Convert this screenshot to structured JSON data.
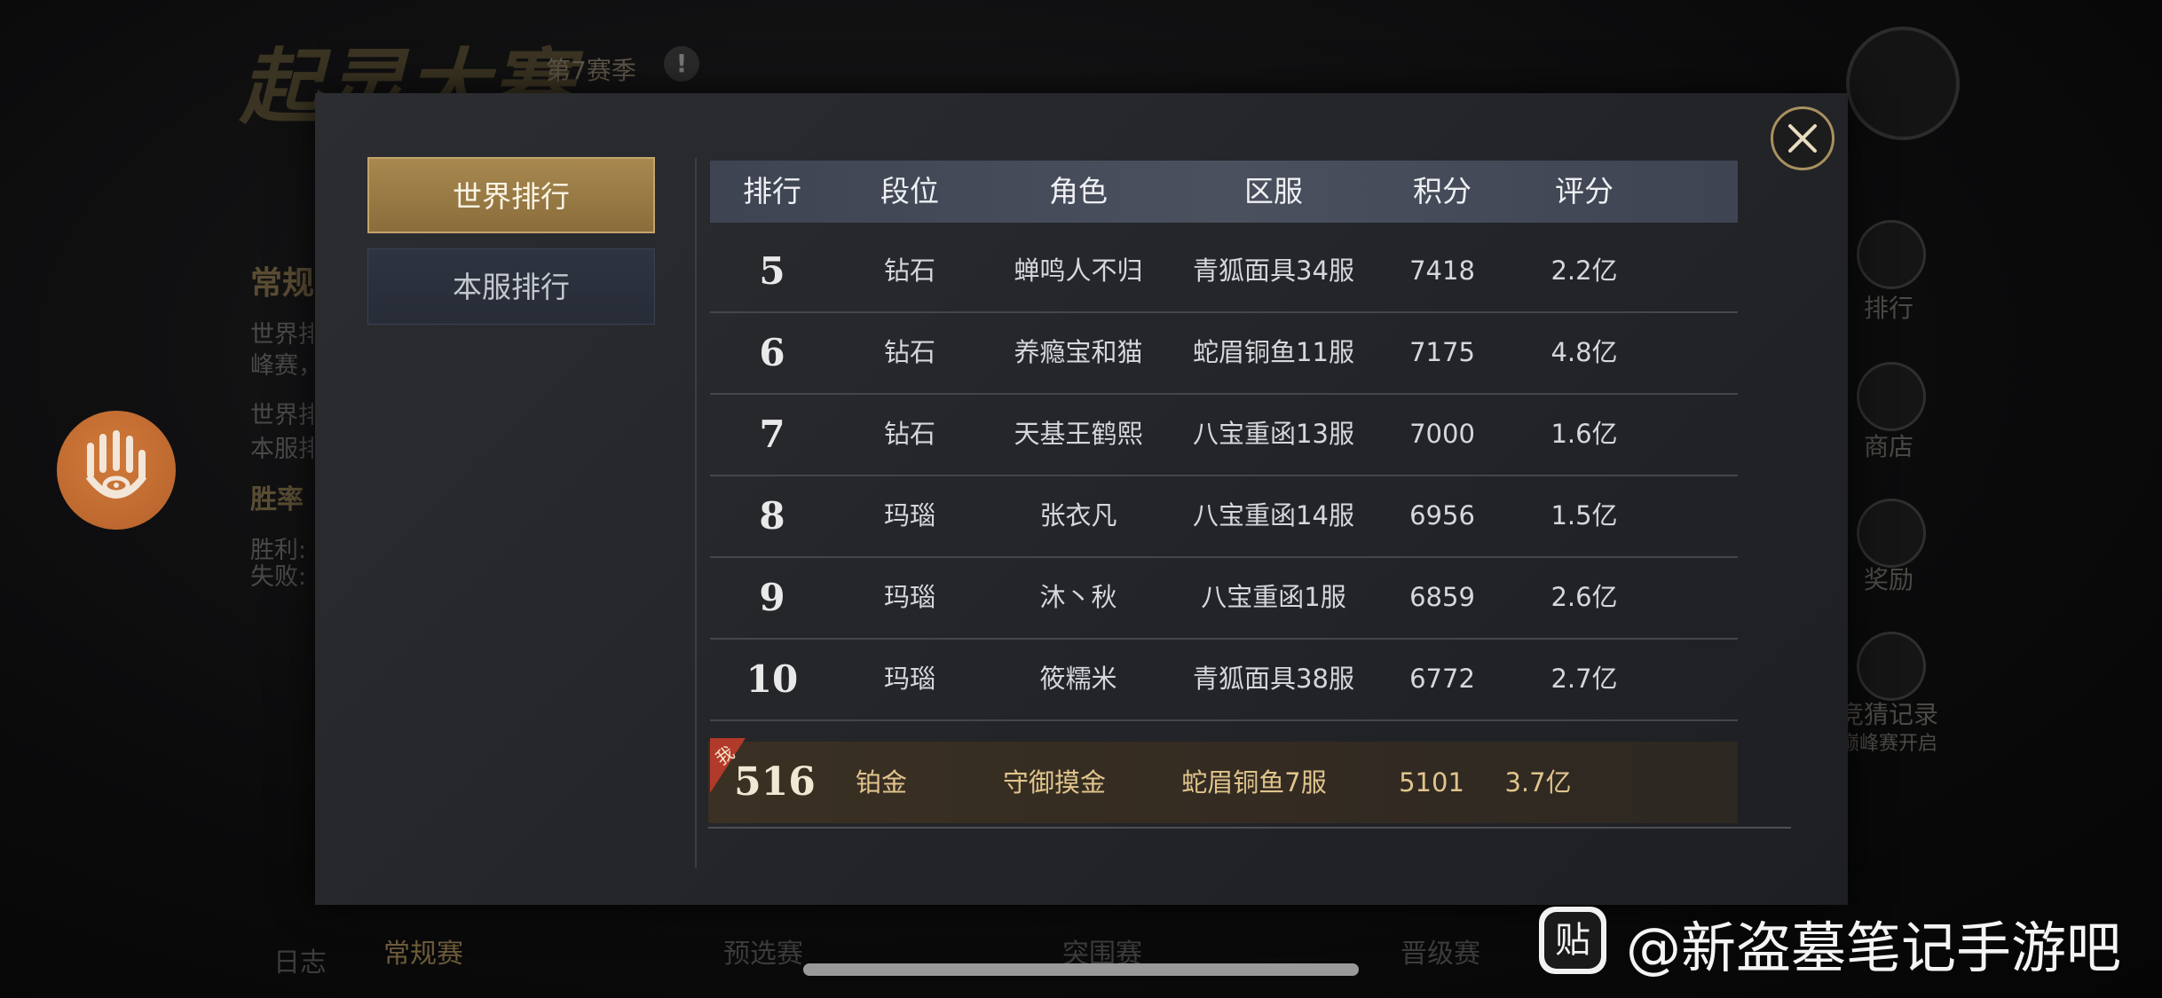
{
  "background": {
    "game_title": "起灵大赛",
    "season": "第7赛季",
    "info_icon": "info-icon",
    "section_heading": "常规",
    "desc_lines": [
      "世界排",
      "峰赛，",
      "世界排",
      "本服排"
    ],
    "winrate_heading": "胜率",
    "win_label": "胜利:",
    "loss_label": "失败:",
    "right_menu": [
      {
        "label": "排行",
        "icon": "trophy-icon"
      },
      {
        "label": "商店",
        "icon": "shop-icon"
      },
      {
        "label": "奖励",
        "icon": "chest-icon"
      },
      {
        "label": "竞猜记录",
        "icon": "quill-icon",
        "sub": "巅峰赛开启"
      }
    ],
    "bottom_tabs": [
      "日志",
      "常规赛",
      "预选赛",
      "突围赛",
      "晋级赛"
    ]
  },
  "modal": {
    "tabs": [
      {
        "label": "世界排行",
        "active": true
      },
      {
        "label": "本服排行",
        "active": false
      }
    ],
    "columns": [
      "排行",
      "段位",
      "角色",
      "区服",
      "积分",
      "评分"
    ],
    "rows": [
      {
        "rank": "5",
        "tier": "钻石",
        "name": "蝉鸣人不归",
        "server": "青狐面具34服",
        "points": "7418",
        "rating": "2.2亿"
      },
      {
        "rank": "6",
        "tier": "钻石",
        "name": "养瘾宝和猫",
        "server": "蛇眉铜鱼11服",
        "points": "7175",
        "rating": "4.8亿"
      },
      {
        "rank": "7",
        "tier": "钻石",
        "name": "天基王鹤熙",
        "server": "八宝重函13服",
        "points": "7000",
        "rating": "1.6亿"
      },
      {
        "rank": "8",
        "tier": "玛瑙",
        "name": "张衣凡",
        "server": "八宝重函14服",
        "points": "6956",
        "rating": "1.5亿"
      },
      {
        "rank": "9",
        "tier": "玛瑙",
        "name": "沐丶秋",
        "server": "八宝重函1服",
        "points": "6859",
        "rating": "2.6亿"
      },
      {
        "rank": "10",
        "tier": "玛瑙",
        "name": "筱糯米",
        "server": "青狐面具38服",
        "points": "6772",
        "rating": "2.7亿"
      }
    ],
    "my_row": {
      "badge": "我",
      "rank": "516",
      "tier": "铂金",
      "name": "守御摸金",
      "server": "蛇眉铜鱼7服",
      "points": "5101",
      "rating": "3.7亿"
    }
  },
  "watermark": {
    "text": "@新盗墓笔记手游吧",
    "icon": "tieba-icon",
    "icon_glyph": "贴"
  }
}
